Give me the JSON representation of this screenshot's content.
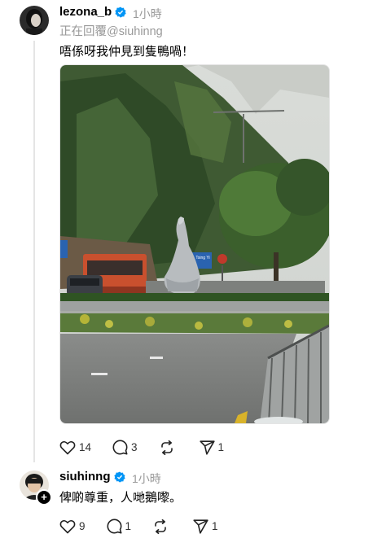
{
  "post1": {
    "username": "lezona_b",
    "time": "1小時",
    "reply_to": "正在回覆@siuhinng",
    "text": "唔係呀我仲見到隻鴨喎！",
    "photo": {
      "road_sign_text": "Tsing Yi"
    },
    "actions": {
      "likes": "14",
      "comments": "3",
      "reposts": "",
      "shares": "1"
    }
  },
  "post2": {
    "username": "siuhinng",
    "time": "1小時",
    "text": "俾啲尊重，人哋鵝嚟。",
    "actions": {
      "likes": "9",
      "comments": "1",
      "reposts": "",
      "shares": "1"
    }
  },
  "colors": {
    "verified": "#0095f6",
    "muted_text": "#999999",
    "thread_line": "#e5e5e5"
  },
  "icons": [
    "heart-icon",
    "comment-icon",
    "repost-icon",
    "share-icon",
    "verified-badge-icon",
    "follow-plus-icon"
  ]
}
